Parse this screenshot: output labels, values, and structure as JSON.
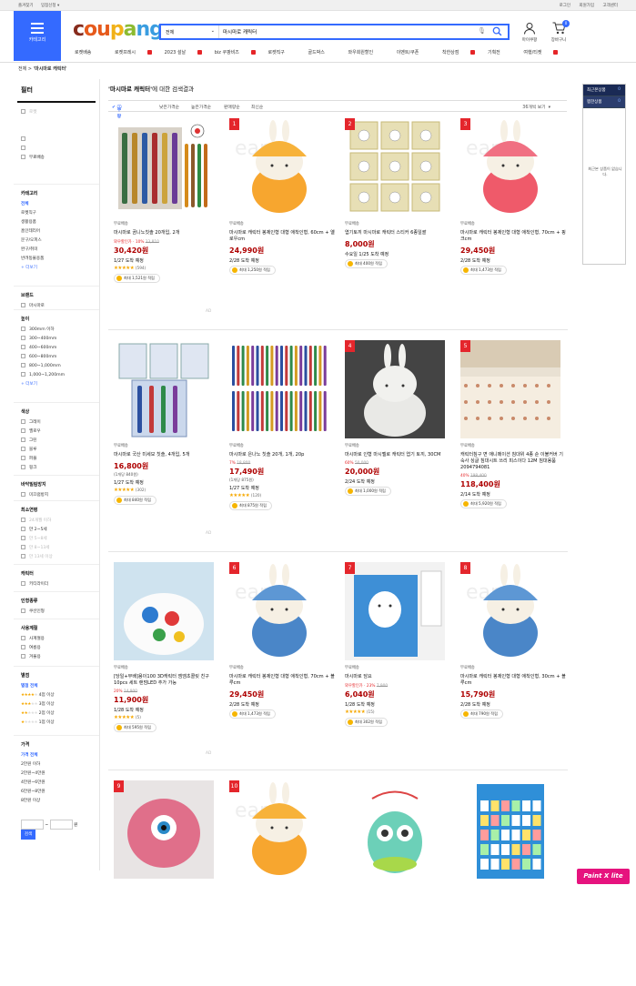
{
  "topbar": {
    "left": [
      "즐겨찾기",
      "입점신청 ▾"
    ],
    "right": [
      "로그인",
      "회원가입",
      "고객센터"
    ]
  },
  "header": {
    "category_label": "카테고리",
    "logo": {
      "c1": "c",
      "c2": "ou",
      "c3": "p",
      "c4": "a",
      "c5": "ng"
    },
    "search": {
      "scope": "전체",
      "value": "마시마로 캐릭터"
    },
    "my_coupang": "마이쿠팡",
    "cart": "장바구니",
    "cart_count": "0"
  },
  "subnav": [
    "로켓배송",
    "로켓프레시",
    "2023 설날",
    "biz 쿠팡비즈",
    "로켓직구",
    "골드박스",
    "와우회원할인",
    "이벤트/쿠폰",
    "착한상점",
    "기획전",
    "여행/티켓"
  ],
  "breadcrumb": {
    "home": "전체",
    "current": "'마시마로 캐릭터'"
  },
  "sidebar": {
    "title": "필터",
    "category": {
      "header": "카테고리",
      "items": [
        "전체",
        "로켓직구",
        "생활용품",
        "홈인테리어",
        "문구/오피스",
        "완구/취미",
        "반려동물용품"
      ],
      "more": "+ 더보기"
    },
    "brand": {
      "header": "브랜드",
      "items": [
        "마시마로"
      ]
    },
    "height": {
      "header": "높이",
      "items": [
        "300mm 이하",
        "300~400mm",
        "400~600mm",
        "600~800mm",
        "800~1,000mm",
        "1,000~1,200mm"
      ],
      "more": "+ 더보기"
    },
    "color": {
      "header": "색상",
      "items": [
        "그레이",
        "옐로우",
        "그린",
        "블루",
        "퍼플",
        "핑크"
      ]
    },
    "antibac": {
      "header": "바닥밀림방지",
      "items": [
        "미끄럼방지"
      ]
    },
    "age": {
      "header": "최소연령",
      "items": [
        "24개월 이하",
        "만 2~5세",
        "만 5~8세",
        "만 8~13세",
        "만 13세 이상"
      ]
    },
    "character": {
      "header": "캐릭터",
      "items": [
        "키티라이더"
      ]
    },
    "doll": {
      "header": "인형종류",
      "items": [
        "쿠션인형"
      ]
    },
    "season": {
      "header": "사용계절",
      "items": [
        "사계절용",
        "여름용",
        "겨울용"
      ]
    },
    "rating": {
      "header": "별점",
      "all": "별점 전체",
      "items": [
        "4점 이상",
        "3점 이상",
        "2점 이상",
        "1점 이상"
      ]
    },
    "price": {
      "header": "가격",
      "all": "가격 전체",
      "items": [
        "2만원 이하",
        "2만원~4만원",
        "4만원~6만원",
        "6만원~8만원",
        "8만원 이상"
      ],
      "won": "원",
      "search": "검색"
    }
  },
  "results": {
    "query": "'마시마로 캐릭터'",
    "suffix": "에 대한 검색결과",
    "sort": [
      "쿠팡 랭킹순",
      "낮은가격순",
      "높은가격순",
      "판매량순",
      "최신순"
    ],
    "per_page": "36개씩 보기"
  },
  "products": [
    {
      "rank": "",
      "ship": "무료배송",
      "name": "마시마로 곰니노칫솔 20개입, 2개",
      "disc": "와우할인가 · 10%",
      "orig": "33,810",
      "price": "30,420원",
      "unit": "",
      "deliv": "1/27 도착 예정",
      "rating_count": "(594)",
      "cash": "최대 1,521원 적립",
      "img": "toothbrush-pack"
    },
    {
      "rank": "1",
      "ship": "무료배송",
      "name": "마시마로 캐릭터 봉제인형 대형 애착인형, 60cm + 옐로우cm",
      "disc": "",
      "orig": "",
      "price": "24,990원",
      "unit": "",
      "deliv": "2/28 도착 예정",
      "rating_count": "",
      "cash": "최대 1,250원 적립",
      "img": "rabbit-yellow"
    },
    {
      "rank": "2",
      "ship": "무료배송",
      "name": "엽기토끼 마시마로 캐릭터 스티커 6종일괄",
      "disc": "",
      "orig": "",
      "price": "8,000원",
      "unit": "",
      "deliv": "수요일 1/25 도착 예정",
      "rating_count": "",
      "cash": "최대 400원 적립",
      "img": "stickers"
    },
    {
      "rank": "3",
      "ship": "무료배송",
      "name": "마시마로 캐릭터 봉제인형 대형 애착인형, 70cm + 핑크cm",
      "disc": "",
      "orig": "",
      "price": "29,450원",
      "unit": "",
      "deliv": "2/28 도착 예정",
      "rating_count": "",
      "cash": "최대 1,473원 적립",
      "img": "rabbit-pink"
    },
    {
      "rank": "",
      "ship": "무료배송",
      "name": "마시마로 국산 미세모 칫솔, 4개입, 5개",
      "disc": "",
      "orig": "",
      "price": "16,800원",
      "unit": "(1개당 840원)",
      "deliv": "1/27 도착 예정",
      "rating_count": "(302)",
      "cash": "최대 840원 적립",
      "img": "toothbrush-4"
    },
    {
      "rank": "",
      "ship": "무료배송",
      "name": "마시마로 은나노 칫솔 20개, 1개, 20p",
      "disc": "7%",
      "orig": "18,800",
      "price": "17,490원",
      "unit": "(1개당 875원)",
      "deliv": "1/27 도착 예정",
      "rating_count": "(120)",
      "cash": "최대 875원 적립",
      "img": "toothbrush-many"
    },
    {
      "rank": "4",
      "ship": "무료배송",
      "name": "마시마로 인형 마시멜로 캐릭터 엽기 토끼, 30CM",
      "disc": "60%",
      "orig": "50,000",
      "price": "20,000원",
      "unit": "",
      "deliv": "2/24 도착 예정",
      "rating_count": "",
      "cash": "최대 1,000원 적립",
      "img": "rabbit-white"
    },
    {
      "rank": "5",
      "ship": "무료배송",
      "name": "캐릭터침구 면 애니메이션 침대위 4종 순 이불커버 기숙사 싱글 침대시트 쓰리 피스이다 12M 침대용품 2094794081",
      "disc": "40%",
      "orig": "198,400",
      "price": "118,400원",
      "unit": "",
      "deliv": "2/14 도착 예정",
      "rating_count": "",
      "cash": "최대 5,920원 적립",
      "img": "bedding"
    },
    {
      "rank": "",
      "ship": "무료배송",
      "name": "[당일+무배]용이100 3D캐릭터 엠엠초콜릿 친구 10pcs 세트 랜덤LED 추가 가능",
      "disc": "20%",
      "orig": "14,900",
      "price": "11,900원",
      "unit": "",
      "deliv": "1/28 도착 예정",
      "rating_count": "(5)",
      "cash": "최대 595원 적립",
      "img": "shoe-charms"
    },
    {
      "rank": "6",
      "ship": "무료배송",
      "name": "마시마로 캐릭터 봉제인형 대형 애착인형, 70cm + 블루cm",
      "disc": "",
      "orig": "",
      "price": "29,450원",
      "unit": "",
      "deliv": "2/28 도착 예정",
      "rating_count": "",
      "cash": "최대 1,473원 적립",
      "img": "rabbit-blue"
    },
    {
      "rank": "7",
      "ship": "무료배송",
      "name": "마시마로 담요",
      "disc": "와우할인가 · 23%",
      "orig": "7,900",
      "price": "6,040원",
      "unit": "",
      "deliv": "1/28 도착 예정",
      "rating_count": "(15)",
      "cash": "최대 302원 적립",
      "img": "blanket"
    },
    {
      "rank": "8",
      "ship": "무료배송",
      "name": "마시마로 캐릭터 봉제인형 대형 애착인형, 30cm + 블루cm",
      "disc": "",
      "orig": "",
      "price": "15,790원",
      "unit": "",
      "deliv": "2/28 도착 예정",
      "rating_count": "",
      "cash": "최대 790원 적립",
      "img": "rabbit-blue"
    },
    {
      "rank": "9",
      "img": "monster"
    },
    {
      "rank": "10",
      "img": "rabbit-yellow"
    },
    {
      "rank": "",
      "img": "owl-toy"
    },
    {
      "rank": "",
      "img": "poster"
    }
  ],
  "ad_label": "AD",
  "right_panel": {
    "recent": "최근본상품",
    "recent_count": "0",
    "wish": "찜한상품",
    "wish_count": "0",
    "empty": "최근본 상품이 없습니다."
  },
  "watermark": "Paint X lite"
}
